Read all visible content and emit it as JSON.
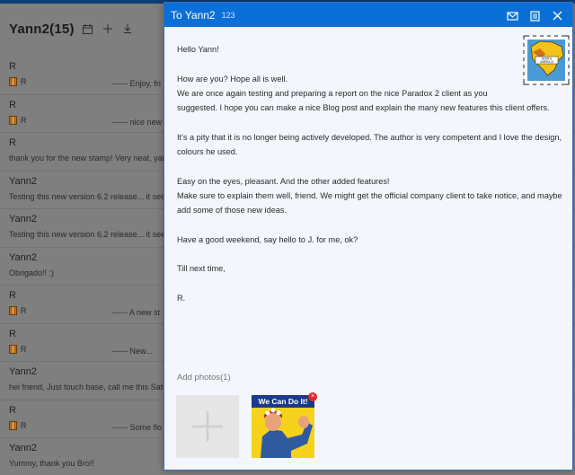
{
  "background": {
    "title": "Yann2(15)",
    "icons": [
      "calendar-icon",
      "plus-icon",
      "download-icon"
    ],
    "rows": [
      {
        "name": "R",
        "from": "R",
        "snippet": "------ Enjoy, fri",
        "has_package": true
      },
      {
        "name": "R",
        "from": "R",
        "snippet": "------ nice new",
        "has_package": true
      },
      {
        "name": "R",
        "from": "",
        "snippet": "thank you for the new stamp! Very neat, yan",
        "has_package": false
      },
      {
        "name": "Yann2",
        "from": "",
        "snippet": "Testing this new version 6.2 release... it seem",
        "has_package": false
      },
      {
        "name": "Yann2",
        "from": "",
        "snippet": "Testing this new version 6.2 release... it seem",
        "has_package": false
      },
      {
        "name": "Yann2",
        "from": "",
        "snippet": "Obrigado!! :)",
        "has_package": false
      },
      {
        "name": "R",
        "from": "R",
        "snippet": "------ A new st",
        "has_package": true
      },
      {
        "name": "R",
        "from": "R",
        "snippet": "------ New...",
        "has_package": true
      },
      {
        "name": "Yann2",
        "from": "",
        "snippet": "hei friend, Just touch base, call me this Satu",
        "has_package": false
      },
      {
        "name": "R",
        "from": "R",
        "snippet": "------ Some flo",
        "has_package": true
      },
      {
        "name": "Yann2",
        "from": "",
        "snippet": "Yummy, thank you Bro!!",
        "has_package": false
      }
    ]
  },
  "compose": {
    "title": "To Yann2",
    "count": "123",
    "actions": [
      "mail-icon",
      "list-icon",
      "close-icon"
    ],
    "body": {
      "greeting": "Hello Yann!",
      "line1": "How are you? Hope all is well.",
      "line2": "We are once again testing and preparing a report on the nice Paradox 2 client as you",
      "line3": "suggested. I hope you can make a nice Blog post and explain the many new features this client offers.",
      "line4": "It's a pity that it is no longer being actively developed. The author is very competent and I love the design,",
      "line5": "colours he used.",
      "line6": "Easy on the eyes, pleasant. And the other added features!",
      "line7": "Make sure to explain them well, friend. We might get the official company client to take notice, and maybe",
      "line8": "add some of those new ideas.",
      "line9": "Have a good weekend, say hello to J. for me, ok?",
      "line10": "Till next time,",
      "signature": "R."
    },
    "stamp": {
      "icon": "stamp-icon",
      "text": "NORTH AMERICA"
    },
    "photos_label": "Add photos(1)",
    "photo": {
      "icon": "photo-thumbnail",
      "caption": "We Can Do It!"
    },
    "remove_label": "×",
    "colors": {
      "titlebar": "#0a6fd6",
      "body": "#f4f6fd"
    }
  }
}
